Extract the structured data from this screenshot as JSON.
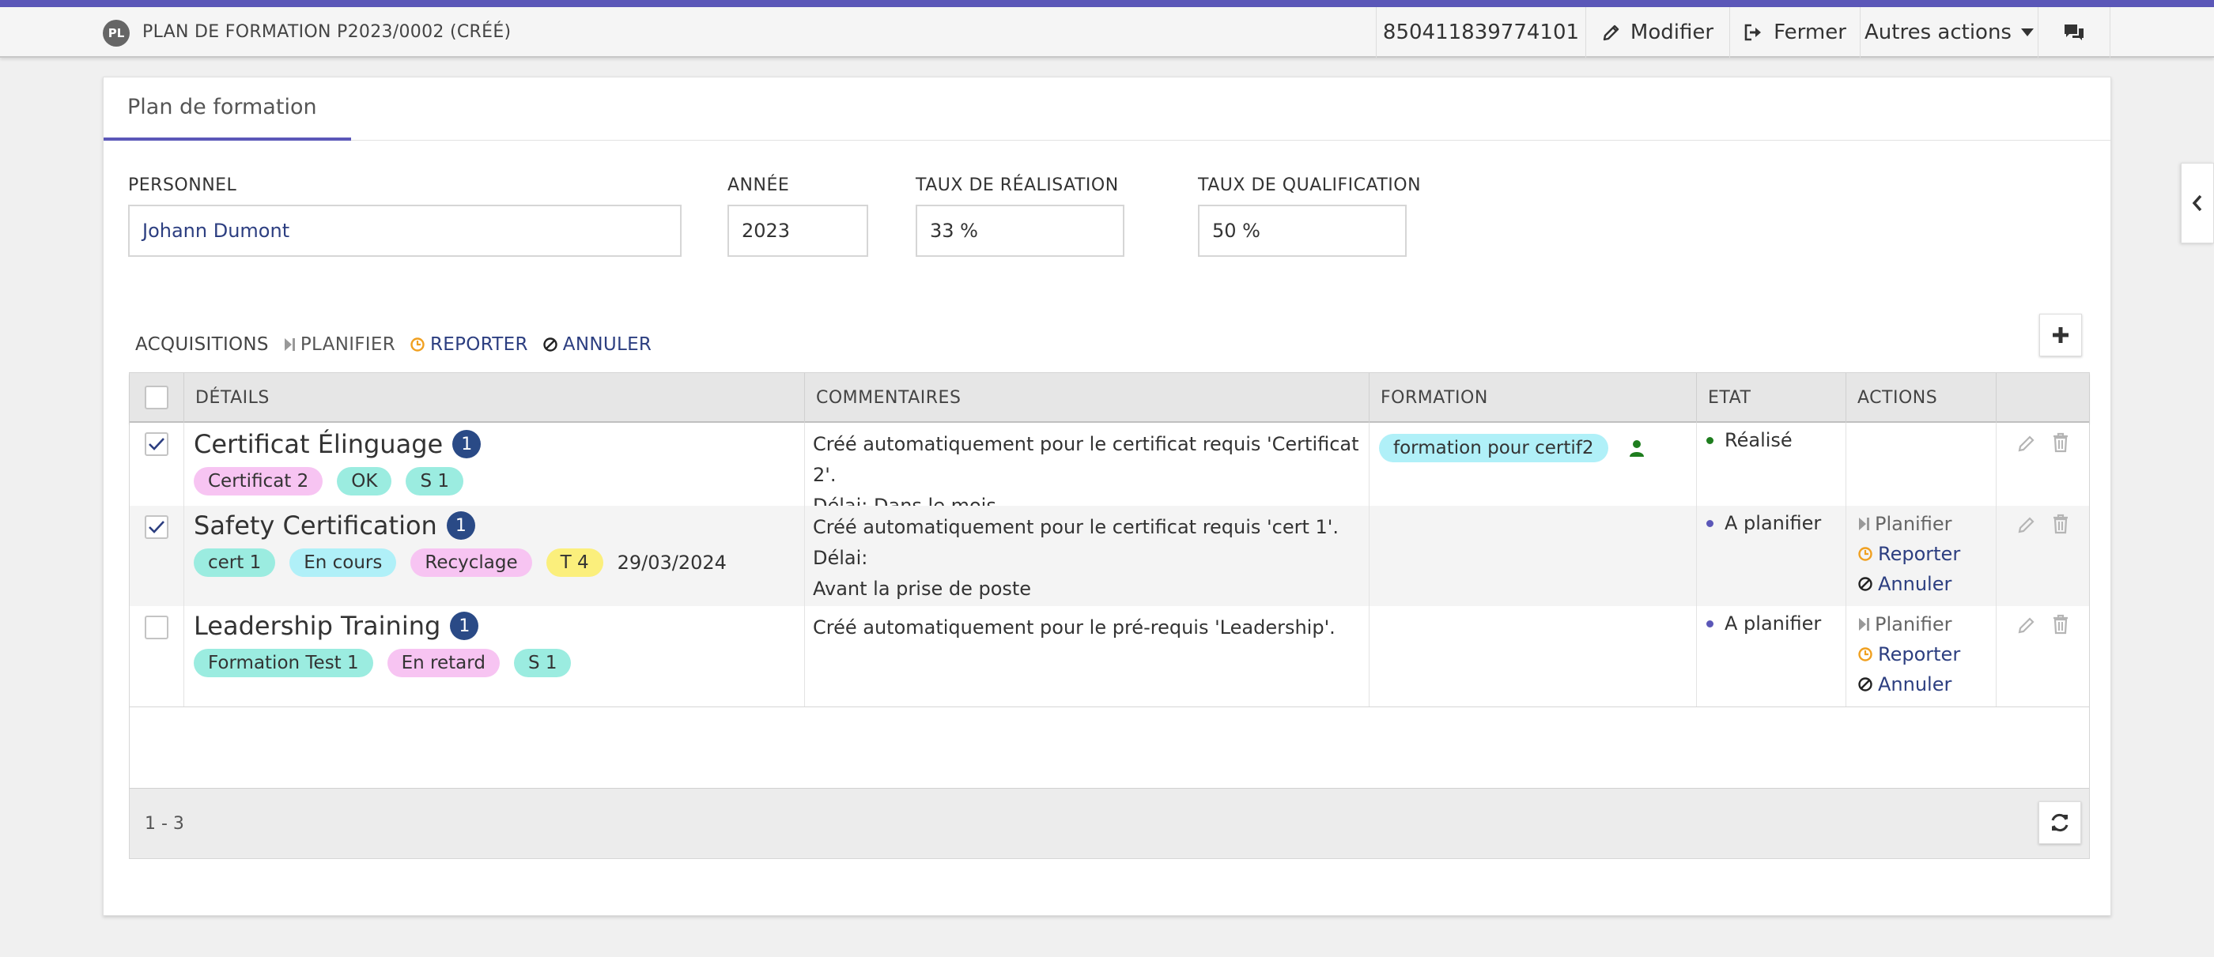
{
  "header": {
    "avatar": "PL",
    "title": "PLAN DE FORMATION P2023/0002 (CRÉÉ)",
    "code": "850411839774101",
    "edit_label": "Modifier",
    "close_label": "Fermer",
    "more_label": "Autres actions"
  },
  "tab": "Plan de formation",
  "form": {
    "personnel_label": "PERSONNEL",
    "personnel_value": "Johann Dumont",
    "year_label": "ANNÉE",
    "year_value": "2023",
    "realisation_label": "TAUX DE RÉALISATION",
    "realisation_value": "33 %",
    "qualification_label": "TAUX DE QUALIFICATION",
    "qualification_value": "50 %"
  },
  "toolbar": {
    "title": "ACQUISITIONS",
    "plan": "PLANIFIER",
    "report": "REPORTER",
    "cancel": "ANNULER"
  },
  "grid": {
    "columns": [
      "DÉTAILS",
      "COMMENTAIRES",
      "FORMATION",
      "ETAT",
      "ACTIONS"
    ],
    "rows": [
      {
        "checked": true,
        "title": "Certificat Élinguage",
        "count": "1",
        "tags": [
          {
            "label": "Certificat 2",
            "color": "pink"
          },
          {
            "label": "OK",
            "color": "teal"
          },
          {
            "label": "S 1",
            "color": "teal"
          }
        ],
        "date": "",
        "comment_1": "Créé automatiquement pour le certificat requis 'Certificat 2'.",
        "comment_2": "Délai: Dans le mois",
        "formation": "formation pour certif2",
        "state": "Réalisé",
        "state_color": "#1e7d1e"
      },
      {
        "checked": true,
        "title": "Safety Certification",
        "count": "1",
        "tags": [
          {
            "label": "cert 1",
            "color": "teal"
          },
          {
            "label": "En cours",
            "color": "cyan"
          },
          {
            "label": "Recyclage",
            "color": "pink"
          },
          {
            "label": "T 4",
            "color": "yellow"
          }
        ],
        "date": "29/03/2024",
        "comment_1": "Créé automatiquement pour le certificat requis 'cert 1'. Délai:",
        "comment_2": "Avant la prise de poste",
        "formation": "",
        "state": "A planifier",
        "state_color": "#5b57b8"
      },
      {
        "checked": false,
        "title": "Leadership Training",
        "count": "1",
        "tags": [
          {
            "label": "Formation Test 1",
            "color": "teal"
          },
          {
            "label": "En retard",
            "color": "pink"
          },
          {
            "label": "S 1",
            "color": "teal"
          }
        ],
        "date": "",
        "comment_1": "Créé automatiquement pour le pré-requis 'Leadership'.",
        "comment_2": "",
        "formation": "",
        "state": "A planifier",
        "state_color": "#5b57b8"
      }
    ],
    "row_actions": {
      "plan": "Planifier",
      "report": "Reporter",
      "cancel": "Annuler"
    },
    "pager": "1 - 3"
  },
  "colors": {
    "accent": "#5b57b8",
    "badge": "#2a4a86",
    "orange": "#f0a020",
    "link": "#2c3e80"
  }
}
